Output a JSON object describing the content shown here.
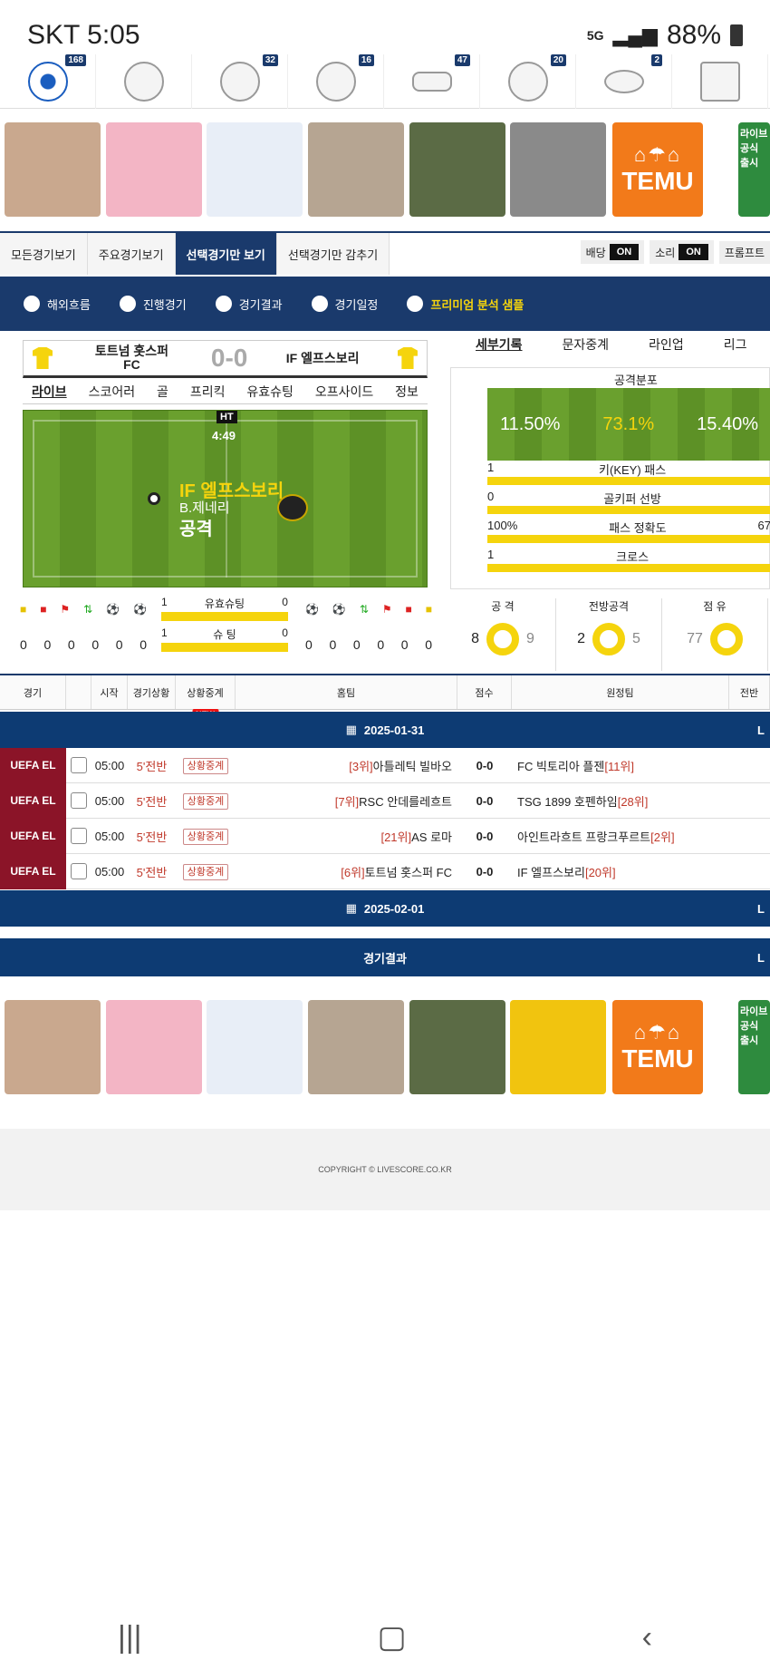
{
  "status": {
    "carrier": "SKT",
    "time": "5:05",
    "network": "5G",
    "battery": "88%"
  },
  "sports": [
    {
      "icon": "soccer-ball-icon",
      "count": "168"
    },
    {
      "icon": "baseball-icon",
      "count": ""
    },
    {
      "icon": "basketball-icon",
      "count": "32"
    },
    {
      "icon": "volleyball-icon",
      "count": "16"
    },
    {
      "icon": "hockey-puck-icon",
      "count": "47"
    },
    {
      "icon": "tennis-ball-icon",
      "count": "20"
    },
    {
      "icon": "football-icon",
      "count": "2"
    },
    {
      "icon": "esports-icon",
      "count": ""
    }
  ],
  "ad": {
    "brand": "TEMU",
    "side_text": "라이브 공식 출시"
  },
  "tabs": [
    "모든경기보기",
    "주요경기보기",
    "선택경기만 보기",
    "선택경기만 감추기"
  ],
  "toggles": [
    {
      "label": "배당",
      "state": "ON"
    },
    {
      "label": "소리",
      "state": "ON"
    },
    {
      "label": "프롬프트",
      "state": ""
    }
  ],
  "filters": [
    "해외흐름",
    "진행경기",
    "경기결과",
    "경기일정",
    "프리미엄 분석 샘플"
  ],
  "match": {
    "home": "토트넘 홋스퍼 FC",
    "away": "IF 엘프스보리",
    "score": "0-0",
    "tabs": [
      "라이브",
      "스코어러",
      "골",
      "프리킥",
      "유효슈팅",
      "오프사이드",
      "정보"
    ],
    "half": "HT",
    "clock": "4:49",
    "event_team": "IF 엘프스보리",
    "event_player": "B.제네리",
    "event_action": "공격",
    "home_counts": [
      "0",
      "0",
      "0",
      "0",
      "0",
      "0"
    ],
    "away_counts": [
      "0",
      "0",
      "0",
      "0",
      "0",
      "0"
    ],
    "on_target": {
      "label": "유효슈팅",
      "home": "1",
      "away": "0"
    },
    "shots": {
      "label": "슈  팅",
      "home": "1",
      "away": "0"
    }
  },
  "detail": {
    "tabs": [
      "세부기록",
      "문자중계",
      "라인업",
      "리그"
    ],
    "attack_title": "공격분포",
    "attack": [
      "11.50%",
      "73.1%",
      "15.40%"
    ],
    "stats": [
      {
        "label": "키(KEY) 패스",
        "home": "1",
        "away": ""
      },
      {
        "label": "골키퍼 선방",
        "home": "0",
        "away": ""
      },
      {
        "label": "패스 정확도",
        "home": "100%",
        "away": "67"
      },
      {
        "label": "크로스",
        "home": "1",
        "away": ""
      }
    ],
    "rings": [
      {
        "label": "공  격",
        "home": "8",
        "away": "9"
      },
      {
        "label": "전방공격",
        "home": "2",
        "away": "5"
      },
      {
        "label": "점 유",
        "home": "77",
        "away": ""
      }
    ]
  },
  "table": {
    "headers": [
      "경기",
      "시작",
      "경기상황",
      "상황중계",
      "홈팀",
      "점수",
      "원정팀",
      "전반"
    ],
    "new_badge": "NEW",
    "date1": "2025-01-31",
    "date2": "2025-02-01",
    "edge": "L",
    "rows": [
      {
        "league": "UEFA EL",
        "time": "05:00",
        "state": "5'전반",
        "live": "상황중계",
        "home_rank": "[3위]",
        "home": "아틀레틱 빌바오",
        "score": "0-0",
        "away": "FC 빅토리아 플젠",
        "away_rank": "[11위]"
      },
      {
        "league": "UEFA EL",
        "time": "05:00",
        "state": "5'전반",
        "live": "상황중계",
        "home_rank": "[7위]",
        "home": "RSC 안데를레흐트",
        "score": "0-0",
        "away": "TSG 1899 호펜하임",
        "away_rank": "[28위]"
      },
      {
        "league": "UEFA EL",
        "time": "05:00",
        "state": "5'전반",
        "live": "상황중계",
        "home_rank": "[21위]",
        "home": "AS 로마",
        "score": "0-0",
        "away": "아인트라흐트 프랑크푸르트",
        "away_rank": "[2위]"
      },
      {
        "league": "UEFA EL",
        "time": "05:00",
        "state": "5'전반",
        "live": "상황중계",
        "home_rank": "[6위]",
        "home": "토트넘 홋스퍼 FC",
        "score": "0-0",
        "away": "IF 엘프스보리",
        "away_rank": "[20위]"
      }
    ],
    "results_title": "경기결과"
  },
  "footer": "COPYRIGHT © LIVESCORE.CO.KR"
}
